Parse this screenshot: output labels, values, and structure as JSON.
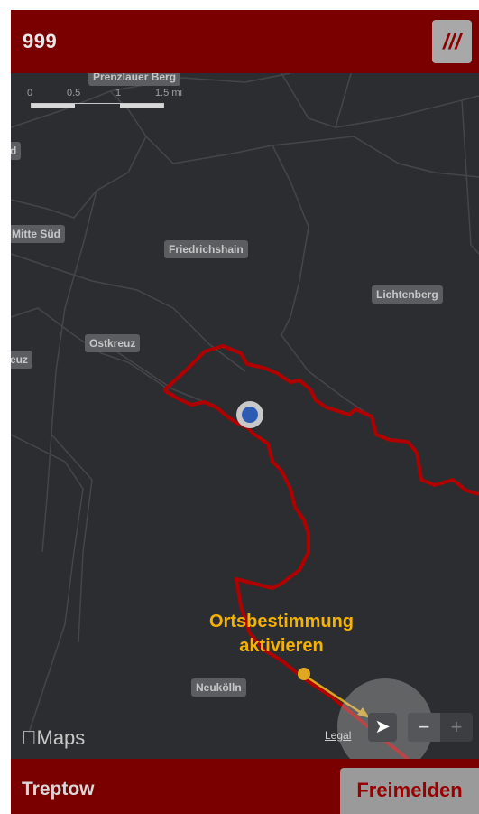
{
  "header": {
    "title": "999",
    "menu_label": "///"
  },
  "map": {
    "scale": {
      "labels": [
        "0",
        "0.5",
        "1",
        "1.5 mi"
      ]
    },
    "districts": {
      "prenzlauer": "Prenzlauer Berg",
      "d_edge": "d",
      "mitte_sued": "Mitte Süd",
      "friedrichshain": "Friedrichshain",
      "lichtenberg": "Lichtenberg",
      "ostkreuz": "Ostkreuz",
      "euz_edge": "euz",
      "neukoelln": "Neukölln"
    },
    "attribution": "Maps",
    "legal": "Legal",
    "locate_icon": "location-arrow-icon",
    "zoom": {
      "minus": "−",
      "plus": "+"
    }
  },
  "hint": {
    "line1": "Ortsbestimmung",
    "line2": "aktivieren"
  },
  "colors": {
    "brand": "#7a0000",
    "boundary": "#b00000",
    "hint": "#f6b200",
    "map_bg": "#2c2d30"
  },
  "footer": {
    "district": "Treptow",
    "report_button": "Freimelden"
  }
}
